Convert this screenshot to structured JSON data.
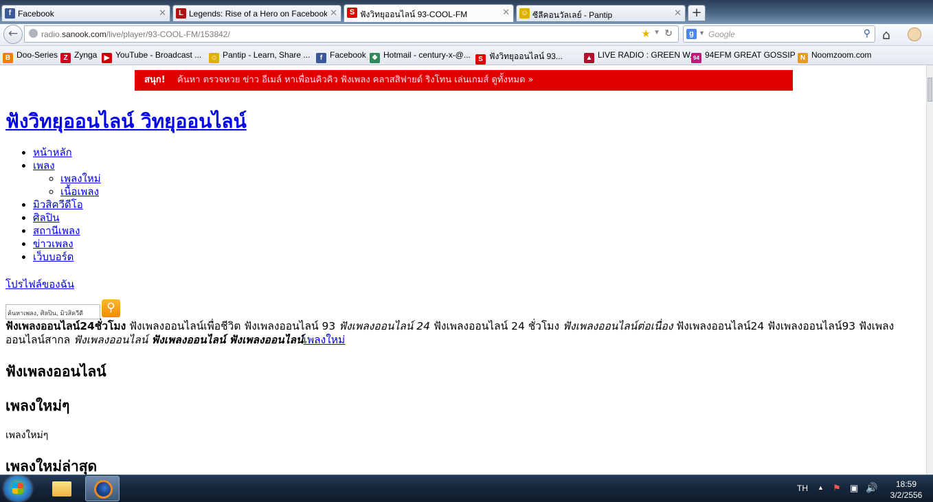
{
  "browser": {
    "tabs": [
      {
        "icon": "facebook-icon",
        "icon_char": "f",
        "icon_color": "#3b5998",
        "title": "Facebook"
      },
      {
        "icon": "legends-icon",
        "icon_char": "L",
        "icon_color": "#b01010",
        "title": "Legends: Rise of a Hero on Facebook"
      },
      {
        "icon": "sanook-icon",
        "icon_char": "S",
        "icon_color": "#e00000",
        "title": "ฟังวิทยุออนไลน์ 93-COOL-FM"
      },
      {
        "icon": "pantip-icon",
        "icon_char": "☺",
        "icon_color": "#e0b000",
        "title": "ซีลีคอนวัลเลย์ - Pantip"
      }
    ],
    "new_tab": "+",
    "url_prefix": "radio.",
    "url_domain": "sanook.com",
    "url_path": "/live/player/93-COOL-FM/153842/",
    "search_placeholder": "Google",
    "bookmarks": [
      {
        "icon": "blogger-icon",
        "icon_char": "B",
        "icon_color": "#f57d00",
        "label": "Doo-Series"
      },
      {
        "icon": "zynga-icon",
        "icon_char": "Z",
        "icon_color": "#d0021b",
        "label": "Zynga"
      },
      {
        "icon": "youtube-icon",
        "icon_char": "▶",
        "icon_color": "#cc0000",
        "label": "YouTube - Broadcast ..."
      },
      {
        "icon": "pantip-icon",
        "icon_char": "☺",
        "icon_color": "#e0b000",
        "label": "Pantip - Learn, Share ..."
      },
      {
        "icon": "facebook-icon",
        "icon_char": "f",
        "icon_color": "#3b5998",
        "label": "Facebook"
      },
      {
        "icon": "msn-icon",
        "icon_char": "❖",
        "icon_color": "#2e8b57",
        "label": "Hotmail - century-x-@..."
      },
      {
        "icon": "sanook-icon",
        "icon_char": "S",
        "icon_color": "#e00000",
        "label": "ฟังวิทยุออนไลน์ 93..."
      },
      {
        "icon": "greenwave-icon",
        "icon_char": "▲",
        "icon_color": "#b0102a",
        "label": "LIVE RADIO : GREEN W..."
      },
      {
        "icon": "94efm-icon",
        "icon_char": "94",
        "icon_color": "#c0187a",
        "label": "94EFM GREAT GOSSIP ..."
      },
      {
        "icon": "noomzoom-icon",
        "icon_char": "N",
        "icon_color": "#e89a20",
        "label": "Noomzoom.com"
      }
    ]
  },
  "page": {
    "topbar_brand": "สนุก!",
    "topbar_links": "ค้นหา  ตรวจหวย  ข่าว  อีเมล์  หาเพื่อนคิวคิว  ฟังเพลง  คลาสสิฟายด์  ริงโทน  เล่นเกมส์  ดูทั้งหมด »",
    "site_title": "ฟังวิทยุออนไลน์ วิทยุออนไลน์",
    "nav": {
      "home": "หน้าหลัก",
      "songs": "เพลง",
      "new_songs": "เพลงใหม่",
      "lyrics": "เนื้อเพลง",
      "mv": "มิวสิควีดีโอ",
      "artists": "ศิลปิน",
      "stations": "สถานีเพลง",
      "news": "ข่าวเพลง",
      "webboard": "เว็บบอร์ด"
    },
    "profile_link": "โปรไฟล์ของฉัน",
    "search_placeholder": "ค้นหาเพลง, ศิลปิน, มิวสิควีดี",
    "para": {
      "p1": "ฟังเพลงออนไลน์24ชั่วโมง",
      "p2": " ฟังเพลงออนไลน์เพื่อชีวิต ฟังเพลงออนไลน์ 93 ",
      "p3": "ฟังเพลงออนไลน์ 24",
      "p4": " ฟังเพลงออนไลน์ 24 ชั่วโมง ",
      "p5": "ฟังเพลงออนไลน์ต่อเนื่อง",
      "p6": " ฟังเพลงออนไลน์24 ฟังเพลงออนไลน์93 ฟังเพลงออนไลน์สากล ",
      "p7": "ฟังเพลงออนไลน์",
      "p8": "ฟังเพลงออนไลน์",
      "p9": "ฟังเพลงออนไลน์",
      "link": "เพลงใหม่"
    },
    "h1": "ฟังเพลงออนไลน์",
    "h2": "เพลงใหม่ๆ",
    "h2_text": "เพลงใหม่ๆ",
    "h3": "เพลงใหม่ล่าสุด"
  },
  "taskbar": {
    "lang": "TH",
    "time": "18:59",
    "date": "3/2/2556"
  }
}
